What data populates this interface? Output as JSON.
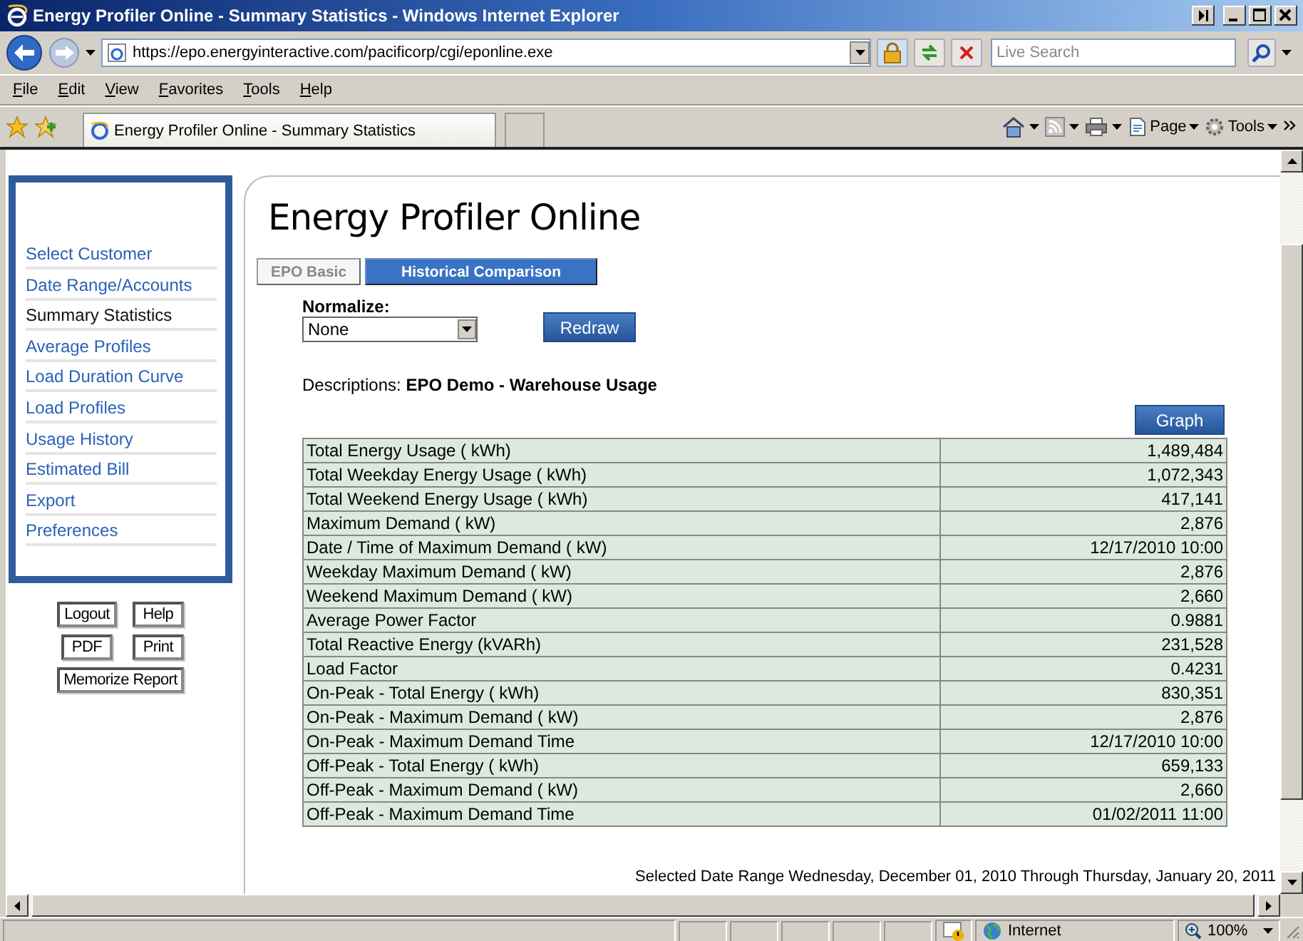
{
  "window": {
    "title": "Energy Profiler Online - Summary Statistics - Windows Internet Explorer"
  },
  "address_bar": {
    "url": "https://epo.energyinteractive.com/pacificorp/cgi/eponline.exe"
  },
  "search": {
    "placeholder": "Live Search"
  },
  "menu": [
    "File",
    "Edit",
    "View",
    "Favorites",
    "Tools",
    "Help"
  ],
  "browser_tabs": [
    {
      "label": "Energy Profiler Online - Summary Statistics",
      "selected": true
    }
  ],
  "command_bar": [
    "Page",
    "Tools"
  ],
  "sidebar": {
    "items": [
      {
        "label": "Select Customer",
        "selected": false
      },
      {
        "label": "Date Range/Accounts",
        "selected": false
      },
      {
        "label": "Summary Statistics",
        "selected": true
      },
      {
        "label": "Average Profiles",
        "selected": false
      },
      {
        "label": "Load Duration Curve",
        "selected": false
      },
      {
        "label": "Load Profiles",
        "selected": false
      },
      {
        "label": "Usage History",
        "selected": false
      },
      {
        "label": "Estimated Bill",
        "selected": false
      },
      {
        "label": "Export",
        "selected": false
      },
      {
        "label": "Preferences",
        "selected": false
      }
    ]
  },
  "side_buttons": [
    "Logout",
    "Help",
    "PDF",
    "Print",
    "Memorize Report"
  ],
  "page": {
    "title": "Energy Profiler Online",
    "tabs": [
      {
        "label": "EPO Basic",
        "selected": false
      },
      {
        "label": "Historical Comparison",
        "selected": true
      }
    ],
    "normalize": {
      "label": "Normalize:",
      "value": "None"
    },
    "redraw": "Redraw",
    "description": "Descriptions: **EPO Demo - Warehouse Usage**",
    "graph": "Graph",
    "rows": [
      {
        "label": "Total Energy Usage ( kWh)",
        "value": "1,489,484"
      },
      {
        "label": "Total Weekday Energy Usage ( kWh)",
        "value": "1,072,343"
      },
      {
        "label": "Total Weekend Energy Usage ( kWh)",
        "value": "417,141"
      },
      {
        "label": "Maximum Demand ( kW)",
        "value": "2,876"
      },
      {
        "label": "Date / Time of Maximum Demand ( kW)",
        "value": "12/17/2010 10:00"
      },
      {
        "label": "Weekday Maximum Demand ( kW)",
        "value": "2,876"
      },
      {
        "label": "Weekend Maximum Demand ( kW)",
        "value": "2,660"
      },
      {
        "label": "Average Power Factor",
        "value": "0.9881"
      },
      {
        "label": "Total Reactive Energy (kVARh)",
        "value": "231,528"
      },
      {
        "label": "Load Factor",
        "value": "0.4231"
      },
      {
        "label": "On-Peak - Total Energy ( kWh)",
        "value": "830,351"
      },
      {
        "label": "On-Peak - Maximum Demand ( kW)",
        "value": "2,876"
      },
      {
        "label": "On-Peak - Maximum Demand Time",
        "value": "12/17/2010 10:00"
      },
      {
        "label": "Off-Peak - Total Energy ( kWh)",
        "value": "659,133"
      },
      {
        "label": "Off-Peak - Maximum Demand ( kW)",
        "value": "2,660"
      },
      {
        "label": "Off-Peak - Maximum Demand Time",
        "value": "01/02/2011 11:00"
      }
    ],
    "footer": "Selected Date Range Wednesday, December 01, 2010 Through Thursday, January 20, 2011"
  },
  "status_bar": {
    "zone": "Internet",
    "zoom": "100%"
  }
}
